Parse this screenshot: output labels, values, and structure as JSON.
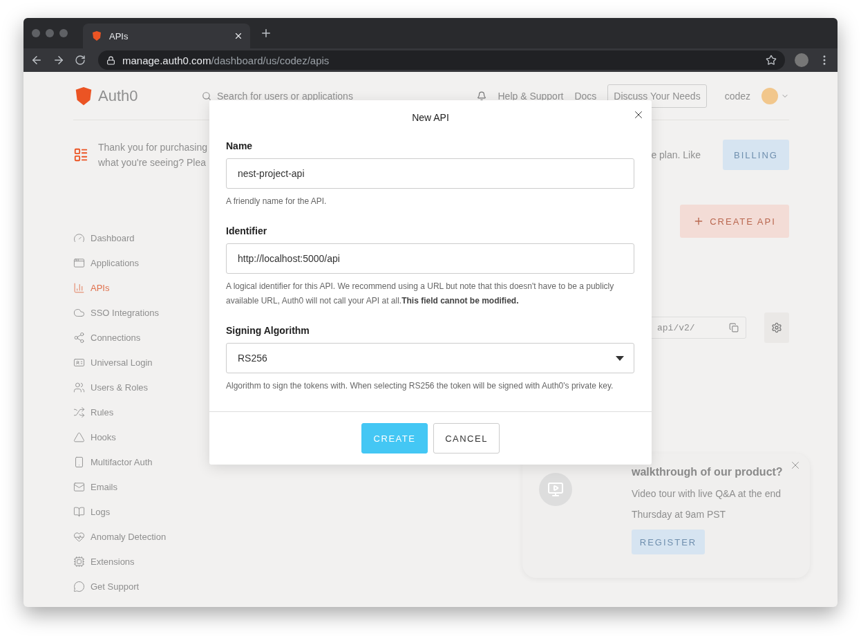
{
  "browser": {
    "tab_title": "APIs",
    "url_host": "manage.auth0.com",
    "url_path": "/dashboard/us/codez/apis"
  },
  "page": {
    "header": {
      "brand": "Auth0",
      "search_placeholder": "Search for users or applications",
      "links": [
        "Help & Support",
        "Docs"
      ],
      "cta": "Discuss Your Needs",
      "user": "codez"
    },
    "banner": {
      "lines": [
        "Thank you for purchasing",
        "what you're seeing? Plea"
      ],
      "tail": "e plan. Like",
      "button": "BILLING"
    },
    "sidebar": {
      "items": [
        {
          "label": "Dashboard",
          "selected": false
        },
        {
          "label": "Applications",
          "selected": false
        },
        {
          "label": "APIs",
          "selected": true
        },
        {
          "label": "SSO Integrations",
          "selected": false
        },
        {
          "label": "Connections",
          "selected": false
        },
        {
          "label": "Universal Login",
          "selected": false
        },
        {
          "label": "Users & Roles",
          "selected": false
        },
        {
          "label": "Rules",
          "selected": false
        },
        {
          "label": "Hooks",
          "selected": false
        },
        {
          "label": "Multifactor Auth",
          "selected": false
        },
        {
          "label": "Emails",
          "selected": false
        },
        {
          "label": "Logs",
          "selected": false
        },
        {
          "label": "Anomaly Detection",
          "selected": false
        },
        {
          "label": "Extensions",
          "selected": false
        },
        {
          "label": "Get Support",
          "selected": false
        }
      ]
    },
    "main": {
      "create_button": "CREATE API",
      "endpoint": "api/v2/",
      "promo": {
        "title": "walkthrough of our product?",
        "subtitle": "Video tour with live Q&A at the end",
        "time": "Thursday at 9am PST",
        "button": "REGISTER"
      }
    }
  },
  "modal": {
    "title": "New API",
    "fields": [
      {
        "kind": "text",
        "label": "Name",
        "value": "nest-project-api",
        "hint": "A friendly name for the API."
      },
      {
        "kind": "text",
        "label": "Identifier",
        "value": "http://localhost:5000/api",
        "hint": "A logical identifier for this API. We recommend using a URL but note that this doesn't have to be a publicly available URL, Auth0 will not call your API at all.**This field cannot be modified.**"
      },
      {
        "kind": "select",
        "label": "Signing Algorithm",
        "value": "RS256",
        "hint": "Algorithm to sign the tokens with. When selecting RS256 the token will be signed with Auth0's private key."
      }
    ],
    "buttons": [
      {
        "label": "CREATE",
        "primary": true
      },
      {
        "label": "CANCEL",
        "primary": false
      }
    ]
  }
}
